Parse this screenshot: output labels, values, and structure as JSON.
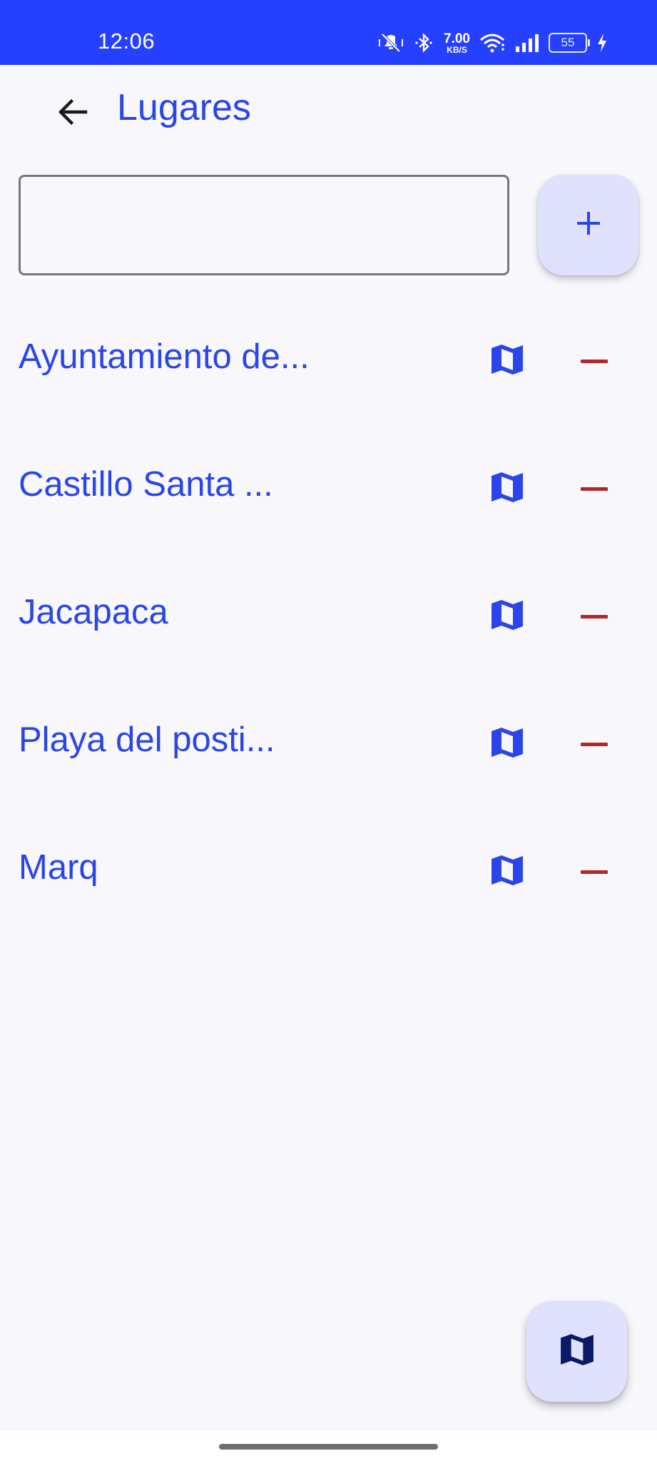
{
  "status_bar": {
    "time": "12:06",
    "net_speed_value": "7.00",
    "net_speed_unit": "KB/S",
    "battery": "55",
    "icons": [
      "mute-vibrate-icon",
      "bluetooth-icon",
      "wifi-icon",
      "signal-icon",
      "battery-icon",
      "charging-icon"
    ]
  },
  "app_bar": {
    "title": "Lugares",
    "back_icon": "arrow-back-icon"
  },
  "search": {
    "value": "",
    "placeholder": ""
  },
  "add_button": {
    "icon": "plus-icon"
  },
  "places": [
    {
      "name": "Ayuntamiento de..."
    },
    {
      "name": "Castillo Santa ..."
    },
    {
      "name": "Jacapaca"
    },
    {
      "name": "Playa del posti..."
    },
    {
      "name": "Marq"
    }
  ],
  "row_actions": {
    "map_icon": "map-icon",
    "remove_icon": "remove-icon"
  },
  "fab": {
    "icon": "map-icon"
  },
  "colors": {
    "status_bar": "#2541ff",
    "primary": "#2a45e8",
    "danger": "#b3262b",
    "container": "#dfe1fd",
    "background": "#f7f7fc",
    "fab_icon": "#0b1a66"
  }
}
